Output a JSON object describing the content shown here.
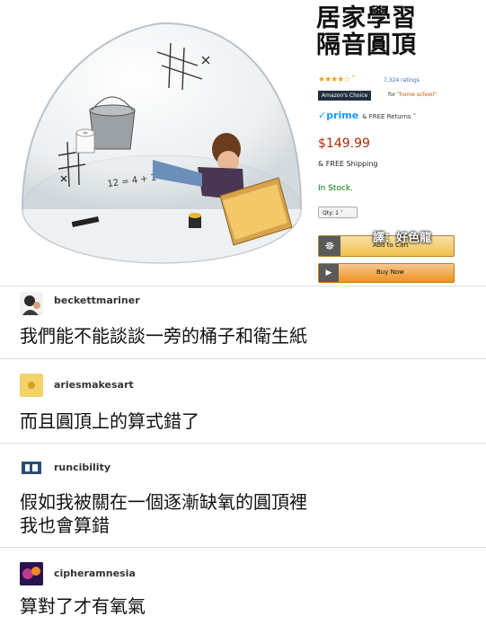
{
  "product": {
    "title_line1": "居家學習",
    "title_line2": "隔音圓頂",
    "stars": "★★★★☆ ˅",
    "ratings": "7,324 ratings",
    "choice_badge": "Amazon's Choice",
    "choice_for": "for",
    "choice_term": "\"home school\"",
    "prime": "✓prime",
    "prime_note": "& FREE Returns ˅",
    "price": "$149.99",
    "shipping": "& FREE Shipping",
    "stock": "In Stock.",
    "qty": "Qty: 1 ˅",
    "cart_label": "Add to Cart",
    "buy_label": "Buy Now",
    "watermark": "譯：好色龍",
    "dome_math": "12 = 4 + 1"
  },
  "comments": [
    {
      "user": "beckettmariner",
      "lines": [
        "我們能不能談談一旁的桶子和衛生紙"
      ]
    },
    {
      "user": "ariesmakesart",
      "lines": [
        "而且圓頂上的算式錯了"
      ]
    },
    {
      "user": "runcibility",
      "lines": [
        "假如我被關在一個逐漸缺氧的圓頂裡",
        "我也會算錯"
      ]
    },
    {
      "user": "cipheramnesia",
      "lines": [
        "算對了才有氧氣"
      ]
    }
  ],
  "colors": {
    "price": "#b12704",
    "stock": "#007600",
    "prime": "#1a98ff",
    "cart_button": "#f0c14b",
    "buy_button": "#ed9220"
  }
}
